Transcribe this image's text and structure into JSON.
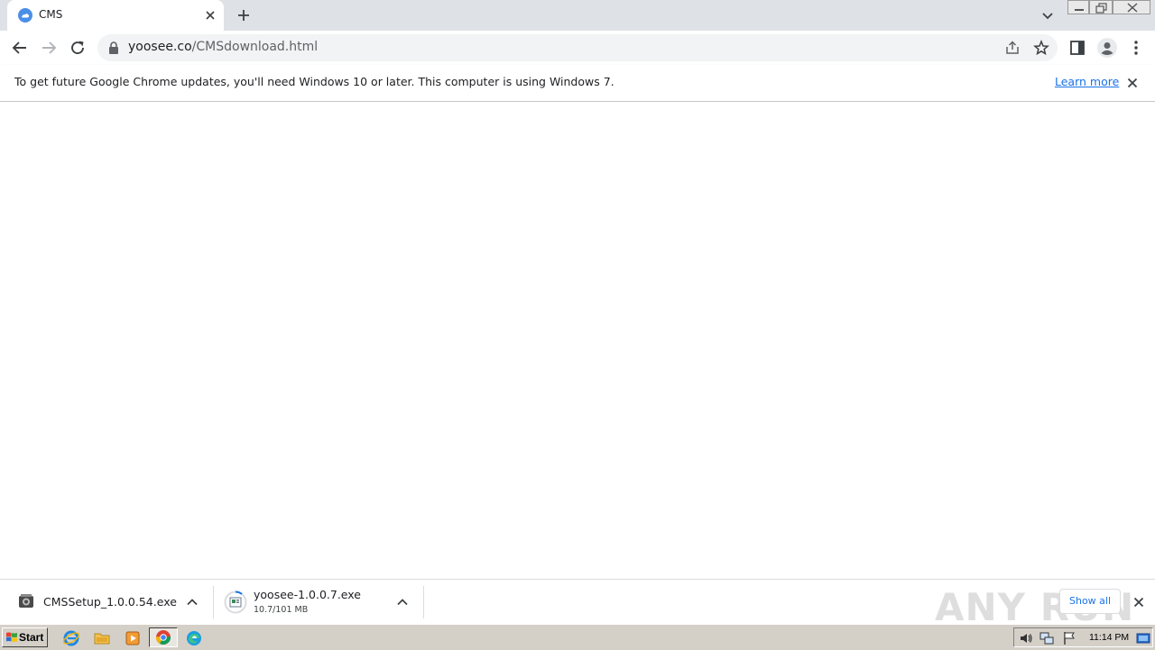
{
  "browser": {
    "tab": {
      "title": "CMS",
      "favicon": "yoosee-cloud-icon"
    },
    "address": {
      "host": "yoosee.co",
      "path": "/CMSdownload.html"
    }
  },
  "infobar": {
    "message": "To get future Google Chrome updates, you'll need Windows 10 or later. This computer is using Windows 7.",
    "link": "Learn more"
  },
  "downloads": {
    "items": [
      {
        "filename": "CMSSetup_1.0.0.54.exe",
        "status": ""
      },
      {
        "filename": "yoosee-1.0.0.7.exe",
        "status": "10.7/101 MB"
      }
    ],
    "show_all": "Show all",
    "watermark": "ANY RUN"
  },
  "taskbar": {
    "start_label": "Start",
    "clock": "11:14 PM",
    "apps": [
      "internet-explorer-icon",
      "file-explorer-icon",
      "media-player-icon",
      "chrome-icon",
      "edge-icon"
    ]
  },
  "colors": {
    "tabstrip": "#dee1e6",
    "accent_link": "#1a73e8",
    "taskbar": "#d4d0c8"
  }
}
